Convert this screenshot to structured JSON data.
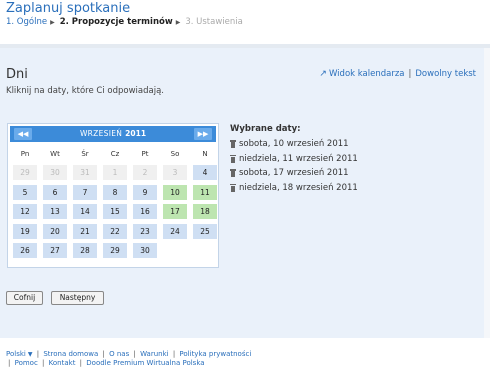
{
  "header": {
    "title": "Zaplanuj spotkanie",
    "steps": [
      {
        "label": "1. Ogólne",
        "state": "done"
      },
      {
        "label": "2. Propozycje terminów",
        "state": "current"
      },
      {
        "label": "3. Ustawienia",
        "state": "future"
      }
    ]
  },
  "section": {
    "title": "Dni",
    "hint": "Kliknij na daty, które Ci odpowiadają.",
    "links": {
      "calendar_view": "Widok kalendarza",
      "free_text": "Dowolny tekst"
    }
  },
  "calendar": {
    "prev": "◀◀",
    "next": "▶▶",
    "month": "WRZESIEŃ",
    "year": "2011",
    "weekdays": [
      "Pn",
      "Wt",
      "Śr",
      "Cz",
      "Pt",
      "So",
      "N"
    ],
    "weeks": [
      [
        {
          "d": "29",
          "muted": true
        },
        {
          "d": "30",
          "muted": true
        },
        {
          "d": "31",
          "muted": true
        },
        {
          "d": "1",
          "muted": true
        },
        {
          "d": "2",
          "muted": true
        },
        {
          "d": "3",
          "muted": true
        },
        {
          "d": "4"
        }
      ],
      [
        {
          "d": "5"
        },
        {
          "d": "6"
        },
        {
          "d": "7"
        },
        {
          "d": "8"
        },
        {
          "d": "9"
        },
        {
          "d": "10",
          "selected": true
        },
        {
          "d": "11",
          "selected": true
        }
      ],
      [
        {
          "d": "12"
        },
        {
          "d": "13"
        },
        {
          "d": "14"
        },
        {
          "d": "15"
        },
        {
          "d": "16"
        },
        {
          "d": "17",
          "selected": true
        },
        {
          "d": "18",
          "selected": true
        }
      ],
      [
        {
          "d": "19"
        },
        {
          "d": "20"
        },
        {
          "d": "21"
        },
        {
          "d": "22"
        },
        {
          "d": "23"
        },
        {
          "d": "24"
        },
        {
          "d": "25"
        }
      ],
      [
        {
          "d": "26"
        },
        {
          "d": "27"
        },
        {
          "d": "28"
        },
        {
          "d": "29"
        },
        {
          "d": "30"
        },
        null,
        null
      ]
    ],
    "colors": {
      "header": "#3c8bd9",
      "day": "#cfdff3",
      "selected": "#bde5b0",
      "muted": "#f0f0f0"
    }
  },
  "selected_dates": {
    "title": "Wybrane daty:",
    "items": [
      "sobota, 10 wrzesień 2011",
      "niedziela, 11 wrzesień 2011",
      "sobota, 17 wrzesień 2011",
      "niedziela, 18 wrzesień 2011"
    ]
  },
  "buttons": {
    "back": "Cofnij",
    "next": "Następny"
  },
  "footer": {
    "language": "Polski",
    "links": [
      "Strona domowa",
      "O nas",
      "Warunki",
      "Polityka prywatności",
      "Pomoc",
      "Kontakt",
      "Doodle Premium Wirtualna Polska"
    ]
  }
}
